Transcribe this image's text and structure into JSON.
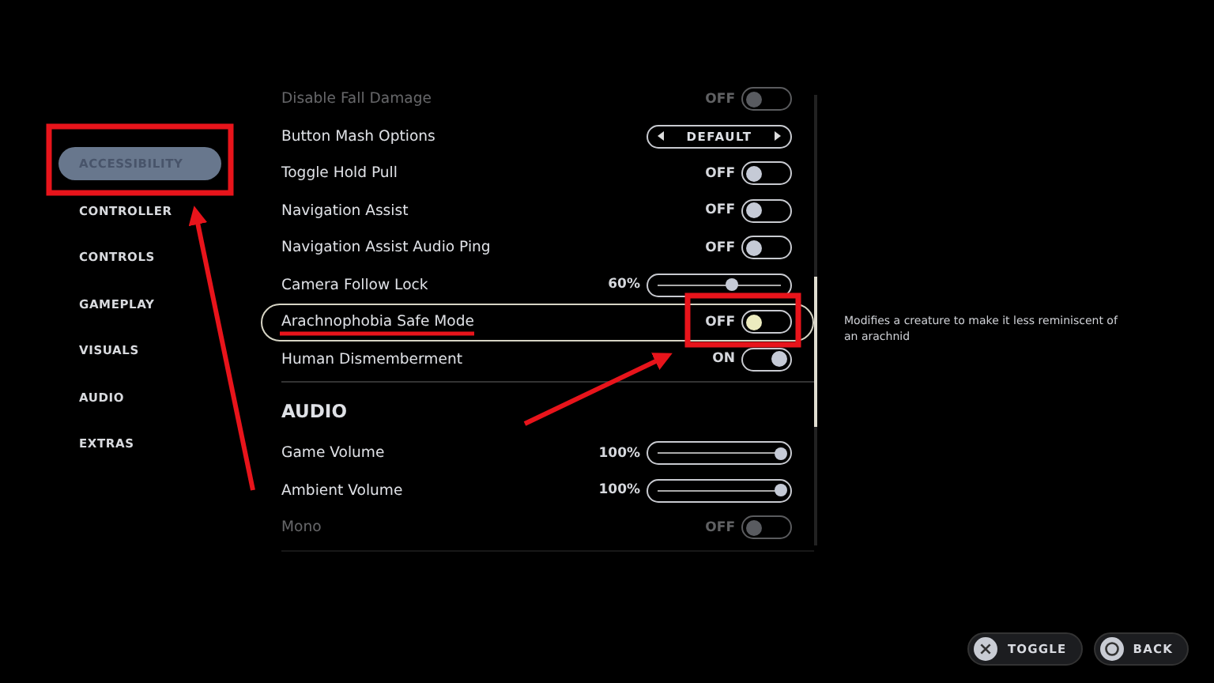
{
  "sidebar": {
    "items": [
      {
        "label": "ACCESSIBILITY",
        "selected": true
      },
      {
        "label": "CONTROLLER",
        "selected": false
      },
      {
        "label": "CONTROLS",
        "selected": false
      },
      {
        "label": "GAMEPLAY",
        "selected": false
      },
      {
        "label": "VISUALS",
        "selected": false
      },
      {
        "label": "AUDIO",
        "selected": false
      },
      {
        "label": "EXTRAS",
        "selected": false
      }
    ]
  },
  "settings": [
    {
      "kind": "toggle",
      "label": "Disable Fall Damage",
      "value": "OFF",
      "on": false,
      "dimmed": true,
      "selected": false
    },
    {
      "kind": "select",
      "label": "Button Mash Options",
      "value": "DEFAULT",
      "dimmed": false,
      "selected": false
    },
    {
      "kind": "toggle",
      "label": "Toggle Hold Pull",
      "value": "OFF",
      "on": false,
      "dimmed": false,
      "selected": false
    },
    {
      "kind": "toggle",
      "label": "Navigation Assist",
      "value": "OFF",
      "on": false,
      "dimmed": false,
      "selected": false
    },
    {
      "kind": "toggle",
      "label": "Navigation Assist Audio Ping",
      "value": "OFF",
      "on": false,
      "dimmed": false,
      "selected": false
    },
    {
      "kind": "slider",
      "label": "Camera Follow Lock",
      "value": "60%",
      "level": 0.6,
      "dimmed": false,
      "selected": false
    },
    {
      "kind": "toggle",
      "label": "Arachnophobia Safe Mode",
      "value": "OFF",
      "on": false,
      "dimmed": false,
      "selected": true
    },
    {
      "kind": "toggle",
      "label": "Human Dismemberment",
      "value": "ON",
      "on": true,
      "dimmed": false,
      "selected": false
    },
    {
      "kind": "header",
      "label": "AUDIO"
    },
    {
      "kind": "slider",
      "label": "Game Volume",
      "value": "100%",
      "level": 1,
      "dimmed": false,
      "selected": false
    },
    {
      "kind": "slider",
      "label": "Ambient Volume",
      "value": "100%",
      "level": 1,
      "dimmed": false,
      "selected": false
    },
    {
      "kind": "toggle",
      "label": "Mono",
      "value": "OFF",
      "on": false,
      "dimmed": true,
      "selected": false
    }
  ],
  "description": "Modifies a creature to make it less reminiscent of an arachnid",
  "footer_buttons": [
    {
      "kind": "cross",
      "label": "TOGGLE"
    },
    {
      "kind": "circle",
      "label": "BACK"
    }
  ]
}
